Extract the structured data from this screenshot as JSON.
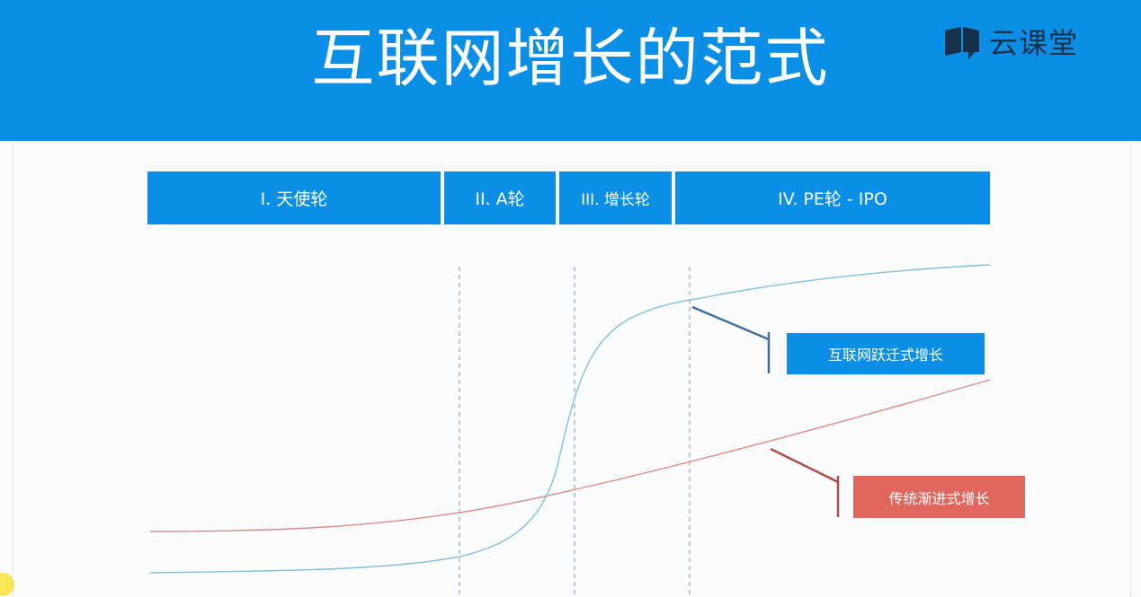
{
  "header": {
    "title": "互联网增长的范式",
    "logo_text": "云课堂",
    "logo_icon": "chat-bubble-book-icon",
    "background_color": "#0b8fe6"
  },
  "stages": [
    {
      "label": "I. 天使轮"
    },
    {
      "label": "II. A轮"
    },
    {
      "label": "III. 增长轮"
    },
    {
      "label": "IV. PE轮 - IPO"
    }
  ],
  "labels": {
    "internet_growth": "互联网跃迁式增长",
    "traditional_growth": "传统渐进式增长"
  },
  "colors": {
    "accent_blue": "#0b8fe6",
    "curve_blue": "#7ec0de",
    "curve_red": "#e08a86",
    "leader_blue": "#3f6f9a",
    "leader_red": "#b24a45",
    "label_red": "#e0675d",
    "divider": "#7a8fb6"
  }
}
